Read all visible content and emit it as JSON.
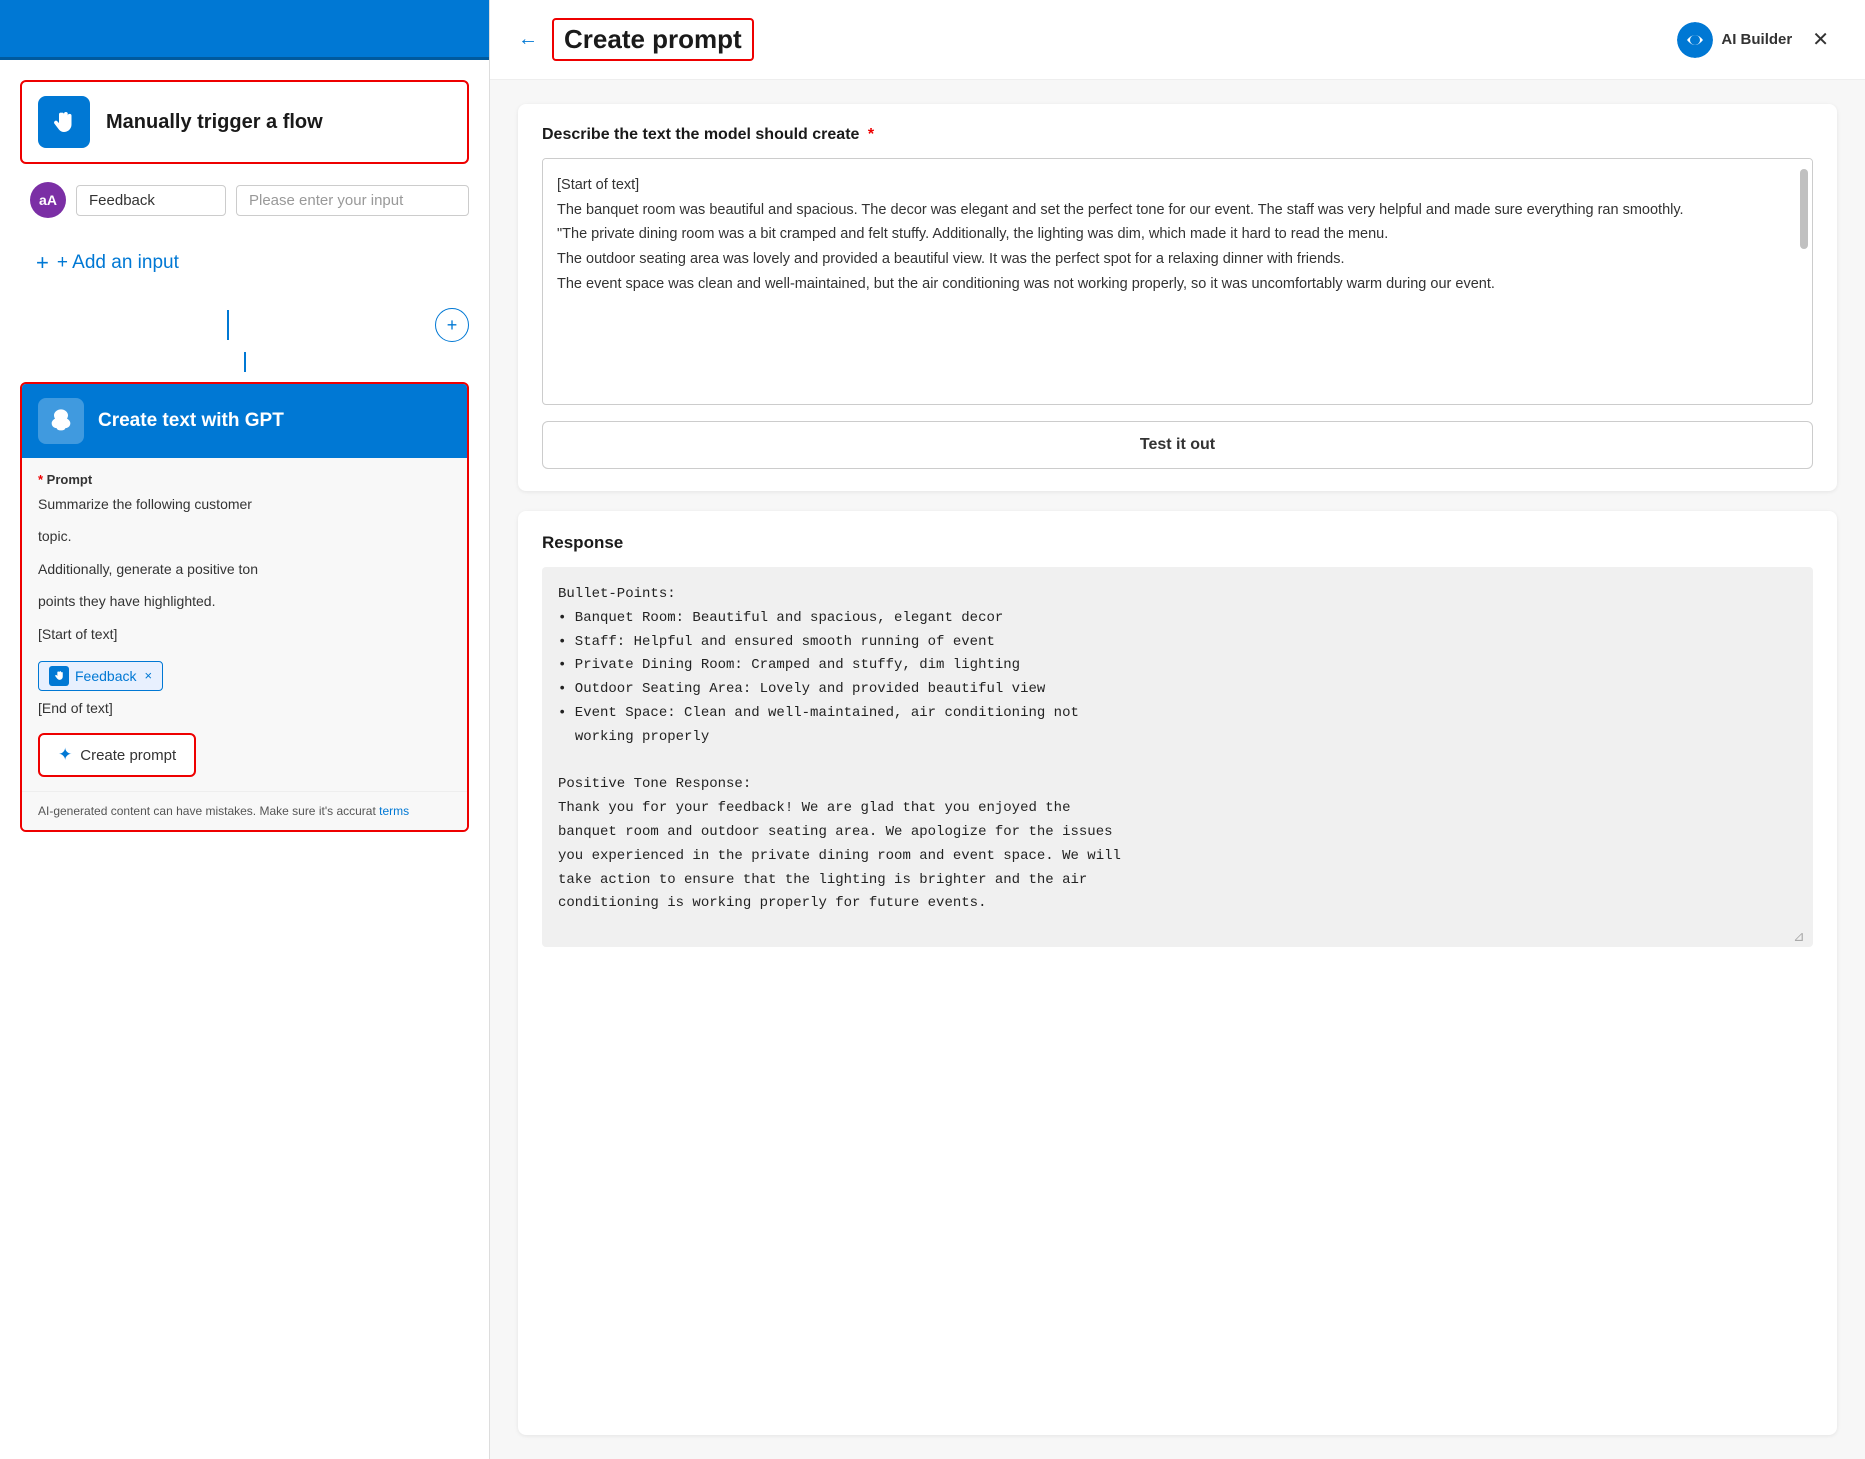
{
  "left": {
    "trigger": {
      "title": "Manually trigger a flow"
    },
    "feedback_row": {
      "avatar": "aA",
      "input_value": "Feedback",
      "placeholder": "Please enter your input"
    },
    "add_input": "+ Add an input",
    "gpt": {
      "title": "Create text with GPT",
      "prompt_label": "* Prompt",
      "prompt_text_1": "Summarize the following customer",
      "prompt_text_2": "topic.",
      "prompt_text_3": "Additionally, generate a positive ton",
      "prompt_text_4": "points they have highlighted.",
      "start_of_text": "[Start of text]",
      "feedback_tag": "Feedback",
      "end_of_text": "[End of text]"
    },
    "create_prompt_btn": "Create prompt",
    "ai_disclaimer": "AI-generated content can have mistakes. Make sure it's accurat",
    "ai_disclaimer_link": "terms"
  },
  "right": {
    "header": {
      "title": "Create prompt",
      "ai_builder_label": "AI Builder"
    },
    "describe": {
      "label": "Describe the text the model should create",
      "required": "*",
      "textarea_content": "[Start of text]\nThe banquet room was beautiful and spacious. The decor was elegant and set the perfect tone for our event. The staff was very helpful and made sure everything ran smoothly.\n\"The private dining room was a bit cramped and felt stuffy. Additionally, the lighting was dim, which made it hard to read the menu.\nThe outdoor seating area was lovely and provided a beautiful view. It was the perfect spot for a relaxing dinner with friends.\nThe event space was clean and well-maintained, but the air conditioning was not working properly, so it was uncomfortably warm during our event."
    },
    "test_btn": "Test it out",
    "response": {
      "label": "Response",
      "content": "Bullet-Points:\n• Banquet Room: Beautiful and spacious, elegant decor\n• Staff: Helpful and ensured smooth running of event\n• Private Dining Room: Cramped and stuffy, dim lighting\n• Outdoor Seating Area: Lovely and provided beautiful view\n• Event Space: Clean and well-maintained, air conditioning not\n  working properly\n\nPositive Tone Response:\nThank you for your feedback! We are glad that you enjoyed the\nbanquet room and outdoor seating area. We apologize for the issues\nyou experienced in the private dining room and event space. We will\ntake action to ensure that the lighting is brighter and the air\nconditioning is working properly for future events."
    }
  }
}
